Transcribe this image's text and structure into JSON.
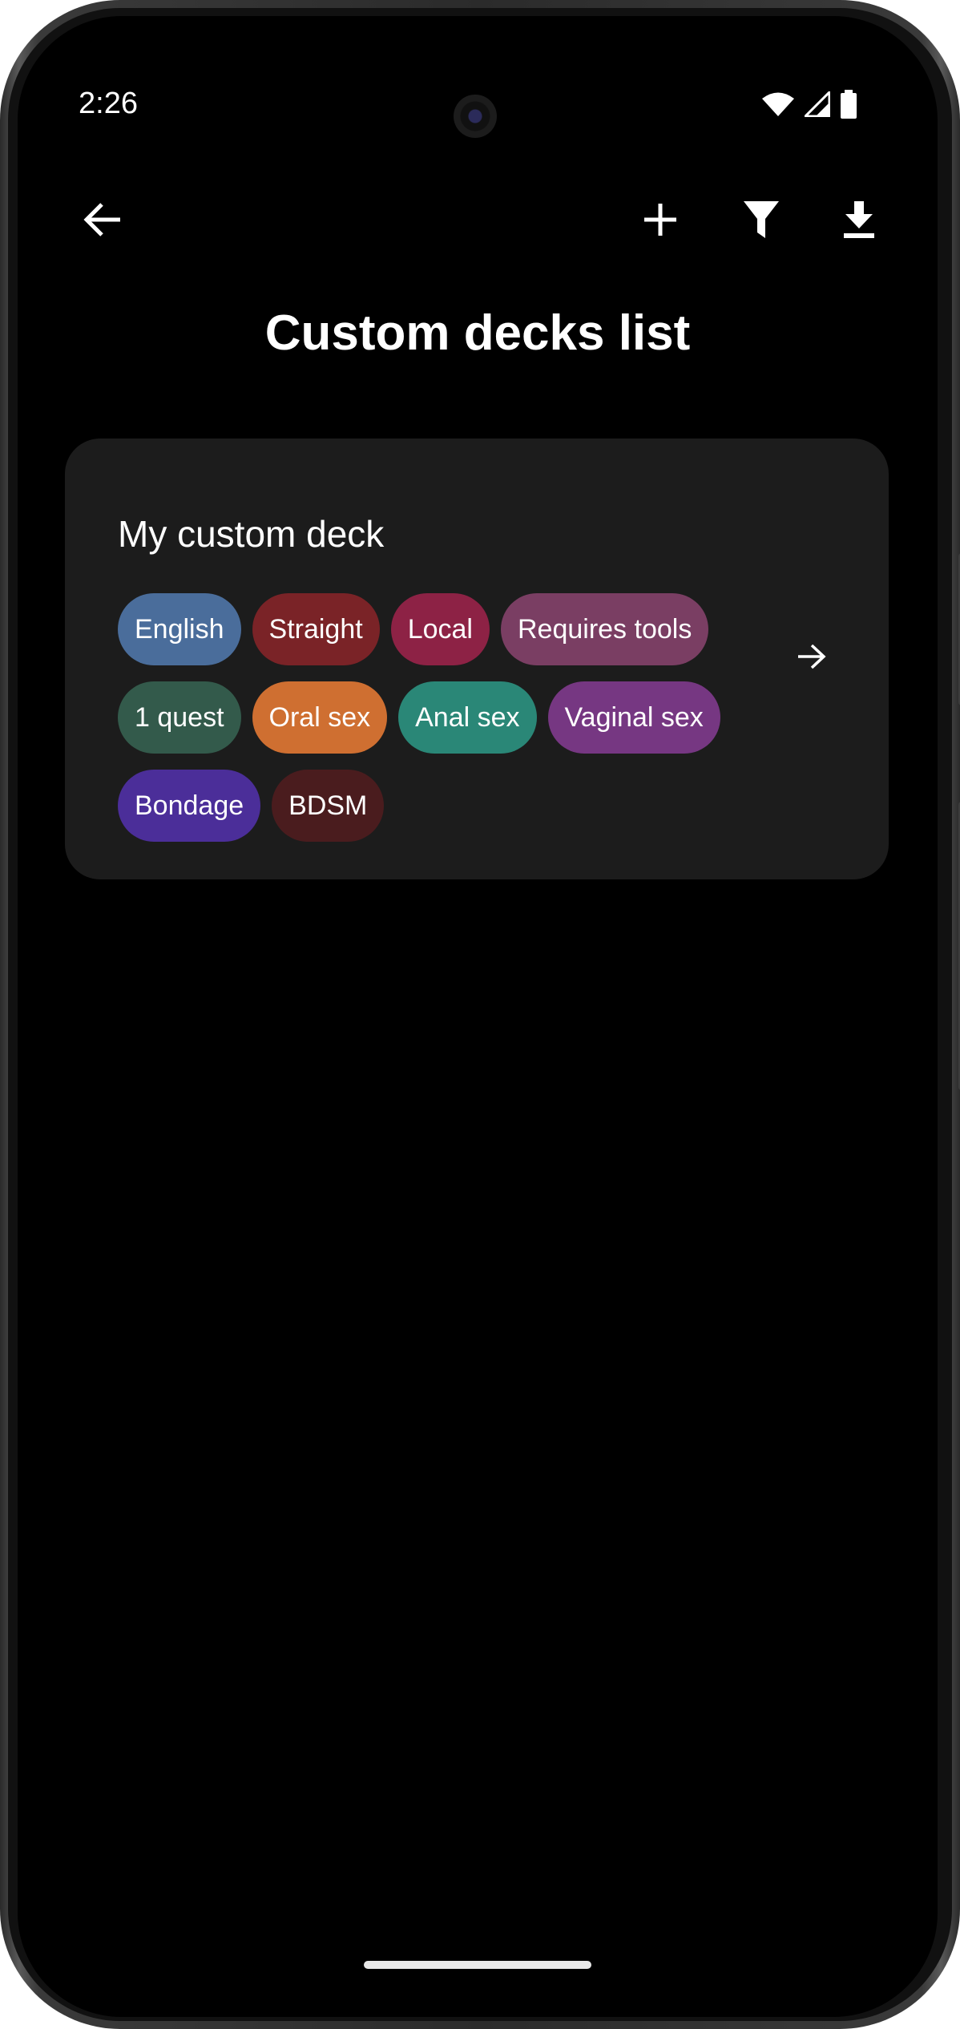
{
  "status_bar": {
    "time": "2:26",
    "icons": [
      "wifi-icon",
      "signal-icon",
      "battery-icon"
    ]
  },
  "toolbar": {
    "back_icon": "arrow-left-icon",
    "actions": [
      "plus-icon",
      "filter-icon",
      "download-icon"
    ]
  },
  "page": {
    "title": "Custom decks list"
  },
  "decks": [
    {
      "name": "My custom deck",
      "open_icon": "arrow-right-icon",
      "tag_rows": [
        [
          {
            "label": "English",
            "color": "#4a6d9b"
          },
          {
            "label": "Straight",
            "color": "#7a2327"
          },
          {
            "label": "Local",
            "color": "#8d2245"
          },
          {
            "label": "Requires tools",
            "color": "#7a3e63"
          }
        ],
        [
          {
            "label": "1 quest",
            "color": "#335a4b"
          },
          {
            "label": "Oral sex",
            "color": "#cf6f31"
          },
          {
            "label": "Anal sex",
            "color": "#2a8777"
          },
          {
            "label": "Vaginal sex",
            "color": "#763782"
          }
        ],
        [
          {
            "label": "Bondage",
            "color": "#4b2e99"
          },
          {
            "label": "BDSM",
            "color": "#4a1c1e"
          }
        ]
      ]
    }
  ]
}
